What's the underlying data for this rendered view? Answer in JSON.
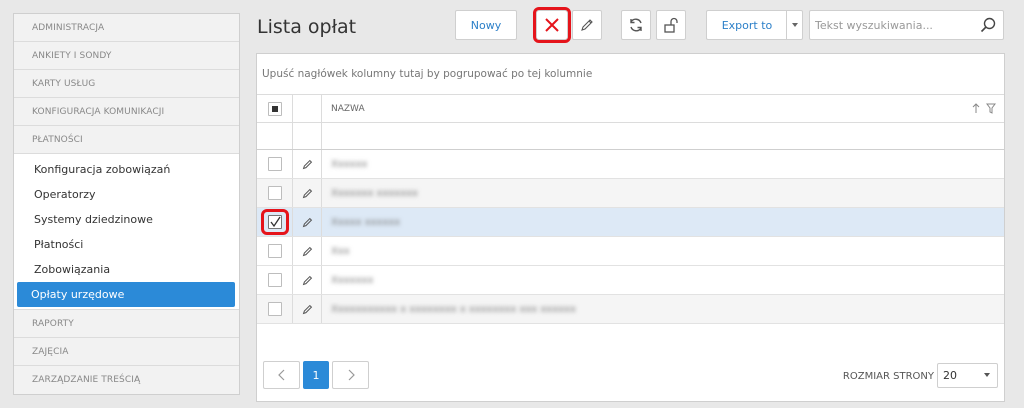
{
  "sidebar": {
    "sections_top": [
      {
        "label": "ADMINISTRACJA"
      },
      {
        "label": "ANKIETY I SONDY"
      },
      {
        "label": "KARTY USŁUG"
      },
      {
        "label": "KONFIGURACJA KOMUNIKACJI"
      },
      {
        "label": "PŁATNOŚCI"
      }
    ],
    "sub_items": [
      {
        "label": "Konfiguracja zobowiązań"
      },
      {
        "label": "Operatorzy"
      },
      {
        "label": "Systemy dziedzinowe"
      },
      {
        "label": "Płatności"
      },
      {
        "label": "Zobowiązania"
      },
      {
        "label": "Opłaty urzędowe",
        "active": true
      }
    ],
    "sections_bottom": [
      {
        "label": "RAPORTY"
      },
      {
        "label": "ZAJĘCIA"
      },
      {
        "label": "ZARZĄDZANIE TREŚCIĄ"
      }
    ]
  },
  "header": {
    "title": "Lista opłat",
    "new_label": "Nowy",
    "export_label": "Export to",
    "search_placeholder": "Tekst wyszukiwania..."
  },
  "grid": {
    "group_hint": "Upuść nagłówek kolumny tutaj by pogrupować po tej kolumnie",
    "column_name": "NAZWA",
    "rows": [
      {
        "name": "Xxxxxx",
        "checked": false
      },
      {
        "name": "Xxxxxxx xxxxxxx",
        "checked": false
      },
      {
        "name": "Xxxxx xxxxxx",
        "checked": true
      },
      {
        "name": "Xxx",
        "checked": false
      },
      {
        "name": "Xxxxxxx",
        "checked": false
      },
      {
        "name": "Xxxxxxxxxxx x xxxxxxxx x xxxxxxxx xxx xxxxxx",
        "checked": false
      }
    ]
  },
  "pager": {
    "current_page": "1",
    "size_label": "ROZMIAR STRONY",
    "size_value": "20"
  },
  "colors": {
    "accent": "#2b8ad8",
    "highlight": "#e5141b",
    "link": "#2b7fc8"
  }
}
